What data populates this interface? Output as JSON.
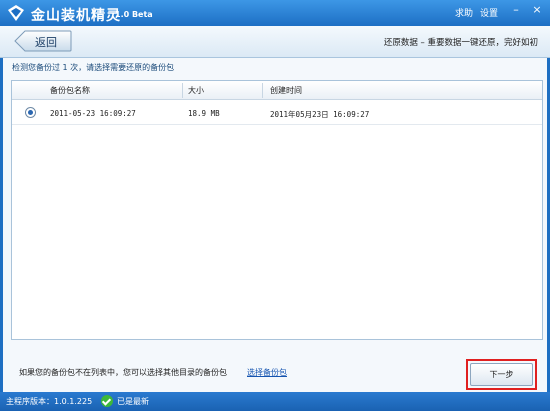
{
  "titlebar": {
    "app_name": "金山装机精灵",
    "version": "1.0 Beta",
    "help_label": "求助",
    "settings_label": "设置",
    "minimize_glyph": "–",
    "close_glyph": "×"
  },
  "nav": {
    "back_label": "返回",
    "description": "还原数据 – 重要数据一键还原，完好如初"
  },
  "content": {
    "hint": "检测您备份过 1 次，请选择需要还原的备份包",
    "table": {
      "columns": [
        "备份包名称",
        "大小",
        "创建时间"
      ],
      "rows": [
        {
          "selected": true,
          "name": "2011-05-23 16:09:27",
          "size": "18.9 MB",
          "created": "2011年05月23日 16:09:27"
        }
      ]
    },
    "footer_text": "如果您的备份包不在列表中，您可以选择其他目录的备份包",
    "footer_link": "选择备份包",
    "next_label": "下一步"
  },
  "statusbar": {
    "version": "主程序版本：1.0.1.225",
    "status": "已是最新",
    "status_icon": "check-circle-icon"
  },
  "colors": {
    "titlebar": "#2a82d6",
    "highlight_border": "#e02020",
    "status_ok": "#3db83a",
    "link": "#1554b0"
  }
}
